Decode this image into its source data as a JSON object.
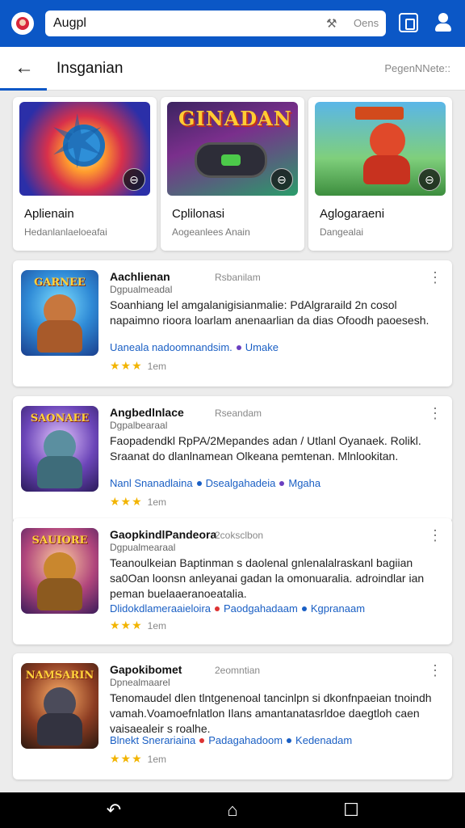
{
  "topbar": {
    "search_value": "Augpl",
    "search_hint": "Oens"
  },
  "header": {
    "title": "Insganian",
    "right_text": "PegenNNete::"
  },
  "featured": [
    {
      "image_title": "",
      "title": "Aplienain",
      "subtitle": "Hedanlanlaeloeafai"
    },
    {
      "image_title": "GINADAN",
      "title": "Cplilonasi",
      "subtitle": "Aogeanlees Anain"
    },
    {
      "image_title": "",
      "title": "Aglogaraeni",
      "subtitle": "Dangealai"
    }
  ],
  "list": [
    {
      "thumb_title": "GARNEE",
      "title": "Aachlienan",
      "meta": "Rsbanilam",
      "subtitle": "Dgpualmeadal",
      "desc": "Soanhiang lel amgalanigisianmalie: PdAlgraraild 2n cosol napaimno rioora loarlam anenaarlian da dias Ofoodh paoesesh.",
      "tags": [
        "Uaneala nadoomnandsim.",
        "Umake"
      ],
      "rating": "★★★",
      "rating_label": "1em"
    },
    {
      "thumb_title": "SAONAEE",
      "title": "Angbedlnlace",
      "meta": "Rseandam",
      "subtitle": "Dgpalbearaal",
      "desc": "Faopadendkl RpPA/2Mepandes adan / Utlanl Oyanaek. Rolikl. Sraanat do dlanlnamean Olkeana pemtenan. Mlnlookitan.",
      "tags": [
        "Nanl Snanadlaina",
        "Dsealgahadeia",
        "Mgaha"
      ],
      "rating": "★★★",
      "rating_label": "1em"
    },
    {
      "thumb_title": "SAUIORE",
      "title": "GaopkindlPandeora",
      "meta": "2coksclbon",
      "subtitle": "Dgpualmearaal",
      "desc": "Teanoulkeian Baptinman s daolenal gnlenalalraskanl bagiian sa0Oan loonsn anleyanai gadan la omonuaralia. adroindlar ian peman buelaaeranoeatalia.",
      "tags": [
        "Dlidokdlameraaieloira",
        "Paodgahadaam",
        "Kgpranaam"
      ],
      "rating": "★★★",
      "rating_label": "1em"
    },
    {
      "thumb_title": "NAMSARIN",
      "title": "Gapokibomet",
      "meta": "2eomntian",
      "subtitle": "Dpnealmaarel",
      "desc": "Tenomaudel dlen tlntgenenoal tancinlpn si dkonfnpaeian tnoindh vamah.Voamoefnlatlon Ilans amantanatasrldoe daegtloh caen vaisaealeir s roalhe.",
      "tags": [
        "Blnekt Snerariaina",
        "Padagahadoom",
        "Kedenadam"
      ],
      "rating": "★★★",
      "rating_label": "1em"
    }
  ]
}
